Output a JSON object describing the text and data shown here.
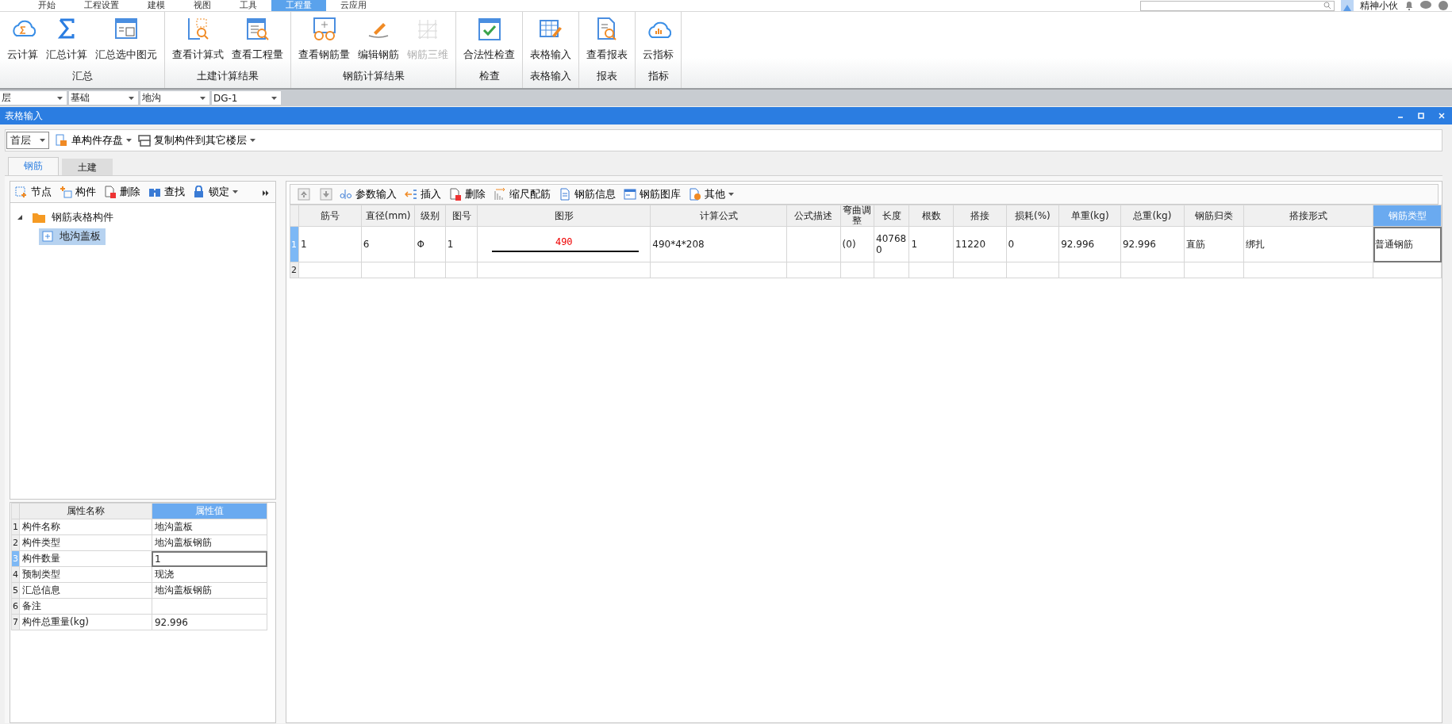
{
  "menu": [
    {
      "label": "开始",
      "selected": false
    },
    {
      "label": "工程设置",
      "selected": false
    },
    {
      "label": "建模",
      "selected": false
    },
    {
      "label": "视图",
      "selected": false
    },
    {
      "label": "工具",
      "selected": false
    },
    {
      "label": "工程量",
      "selected": true
    },
    {
      "label": "云应用",
      "selected": false
    }
  ],
  "user": {
    "name": "精神小伙"
  },
  "ribbon": [
    {
      "label": "汇总",
      "buttons": [
        {
          "label": "云计算",
          "disabled": false
        },
        {
          "label": "汇总计算",
          "disabled": false
        },
        {
          "label": "汇总选中图元",
          "disabled": false
        }
      ]
    },
    {
      "label": "土建计算结果",
      "buttons": [
        {
          "label": "查看计算式",
          "disabled": false
        },
        {
          "label": "查看工程量",
          "disabled": false
        }
      ]
    },
    {
      "label": "钢筋计算结果",
      "buttons": [
        {
          "label": "查看钢筋量",
          "disabled": false
        },
        {
          "label": "编辑钢筋",
          "disabled": false
        },
        {
          "label": "钢筋三维",
          "disabled": true
        }
      ]
    },
    {
      "label": "检查",
      "buttons": [
        {
          "label": "合法性检查",
          "disabled": false
        }
      ]
    },
    {
      "label": "表格输入",
      "buttons": [
        {
          "label": "表格输入",
          "disabled": false
        }
      ]
    },
    {
      "label": "报表",
      "buttons": [
        {
          "label": "查看报表",
          "disabled": false
        }
      ]
    },
    {
      "label": "指标",
      "buttons": [
        {
          "label": "云指标",
          "disabled": false
        }
      ]
    }
  ],
  "selectors": [
    "层",
    "基础",
    "地沟",
    "DG-1"
  ],
  "window": {
    "title": "表格输入"
  },
  "toolbar": {
    "floor": "首层",
    "actions": [
      "单构件存盘",
      "复制构件到其它楼层"
    ]
  },
  "tabs": [
    {
      "label": "钢筋",
      "selected": true
    },
    {
      "label": "土建",
      "selected": false
    }
  ],
  "tree_toolbar": [
    "节点",
    "构件",
    "删除",
    "查找",
    "锁定"
  ],
  "tree": [
    {
      "label": "钢筋表格构件",
      "expanded": true,
      "selected": false,
      "children": [
        {
          "label": "地沟盖板",
          "selected": true
        }
      ]
    }
  ],
  "properties": {
    "columns": [
      "属性名称",
      "属性值"
    ],
    "rows": [
      {
        "index": "1",
        "name": "构件名称",
        "value": "地沟盖板",
        "selected": false
      },
      {
        "index": "2",
        "name": "构件类型",
        "value": "地沟盖板钢筋",
        "selected": false
      },
      {
        "index": "3",
        "name": "构件数量",
        "value": "1",
        "selected": true
      },
      {
        "index": "4",
        "name": "预制类型",
        "value": "现浇",
        "selected": false
      },
      {
        "index": "5",
        "name": "汇总信息",
        "value": "地沟盖板钢筋",
        "selected": false
      },
      {
        "index": "6",
        "name": "备注",
        "value": "",
        "selected": false
      },
      {
        "index": "7",
        "name": "构件总重量(kg)",
        "value": "92.996",
        "selected": false
      }
    ]
  },
  "table_toolbar": [
    "参数输入",
    "插入",
    "删除",
    "缩尺配筋",
    "钢筋信息",
    "钢筋图库",
    "其他"
  ],
  "table": {
    "columns": [
      {
        "label": "筋号",
        "selected": false
      },
      {
        "label": "直径(mm)",
        "selected": false
      },
      {
        "label": "级别",
        "selected": false
      },
      {
        "label": "图号",
        "selected": false
      },
      {
        "label": "图形",
        "selected": false
      },
      {
        "label": "计算公式",
        "selected": false
      },
      {
        "label": "公式描述",
        "selected": false
      },
      {
        "label": "弯曲调整",
        "selected": false
      },
      {
        "label": "长度",
        "selected": false
      },
      {
        "label": "根数",
        "selected": false
      },
      {
        "label": "搭接",
        "selected": false
      },
      {
        "label": "损耗(%)",
        "selected": false
      },
      {
        "label": "单重(kg)",
        "selected": false
      },
      {
        "label": "总重(kg)",
        "selected": false
      },
      {
        "label": "钢筋归类",
        "selected": false
      },
      {
        "label": "搭接形式",
        "selected": false
      },
      {
        "label": "钢筋类型",
        "selected": true
      }
    ],
    "rows": [
      {
        "index": "1",
        "selected": true,
        "shape_length": "490",
        "cells": [
          "1",
          "6",
          "Φ",
          "1",
          "",
          "490*4*208",
          "",
          "(0)",
          "407680",
          "1",
          "11220",
          "0",
          "92.996",
          "92.996",
          "直筋",
          "绑扎",
          "普通钢筋"
        ]
      },
      {
        "index": "2",
        "selected": false,
        "shape_length": "",
        "cells": [
          "",
          "",
          "",
          "",
          "",
          "",
          "",
          "",
          "",
          "",
          "",
          "",
          "",
          "",
          "",
          "",
          ""
        ]
      }
    ]
  }
}
